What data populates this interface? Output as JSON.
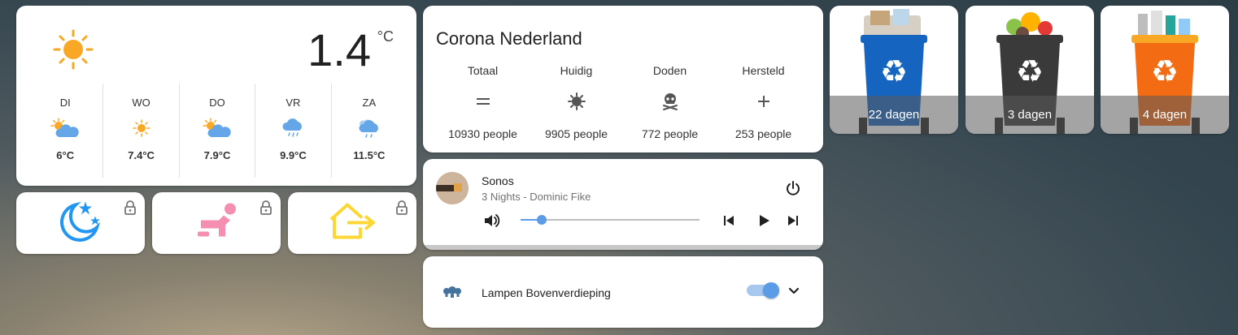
{
  "weather": {
    "current_temp": "1.4",
    "unit": "°C",
    "current_icon": "sunny-icon",
    "forecast": [
      {
        "day": "DI",
        "temp": "6°C",
        "icon": "partly-cloudy-icon"
      },
      {
        "day": "WO",
        "temp": "7.4°C",
        "icon": "sunny-icon"
      },
      {
        "day": "DO",
        "temp": "7.9°C",
        "icon": "partly-cloudy-icon"
      },
      {
        "day": "VR",
        "temp": "9.9°C",
        "icon": "rainy-icon"
      },
      {
        "day": "ZA",
        "temp": "11.5°C",
        "icon": "cloudy-rain-icon"
      }
    ]
  },
  "tiles": [
    {
      "icon": "night-mode-icon",
      "locked": true
    },
    {
      "icon": "person-sleeping-icon",
      "locked": true
    },
    {
      "icon": "leave-home-icon",
      "locked": true
    }
  ],
  "corona": {
    "title": "Corona Nederland",
    "columns": [
      {
        "label": "Totaal",
        "icon": "equals-icon",
        "value": "10930 people"
      },
      {
        "label": "Huidig",
        "icon": "virus-icon",
        "value": "9905 people"
      },
      {
        "label": "Doden",
        "icon": "skull-icon",
        "value": "772 people"
      },
      {
        "label": "Hersteld",
        "icon": "plus-icon",
        "value": "253 people"
      }
    ]
  },
  "sonos": {
    "name": "Sonos",
    "track": "3 Nights - Dominic Fike",
    "volume": 0.12
  },
  "lamps": {
    "name": "Lampen Bovenverdieping",
    "state": "on"
  },
  "bins": [
    {
      "label": "22 dagen",
      "color": "#1565c0"
    },
    {
      "label": "3 dagen",
      "color": "#3a3a3a"
    },
    {
      "label": "4 dagen",
      "color": "#f36b12"
    }
  ],
  "colors": {
    "accent": "#5c9ce6",
    "sun": "#f9a825",
    "cloud": "#64a6e8",
    "tile_night": "#2196f3",
    "tile_person": "#f48fb1",
    "tile_away": "#fdd835"
  }
}
